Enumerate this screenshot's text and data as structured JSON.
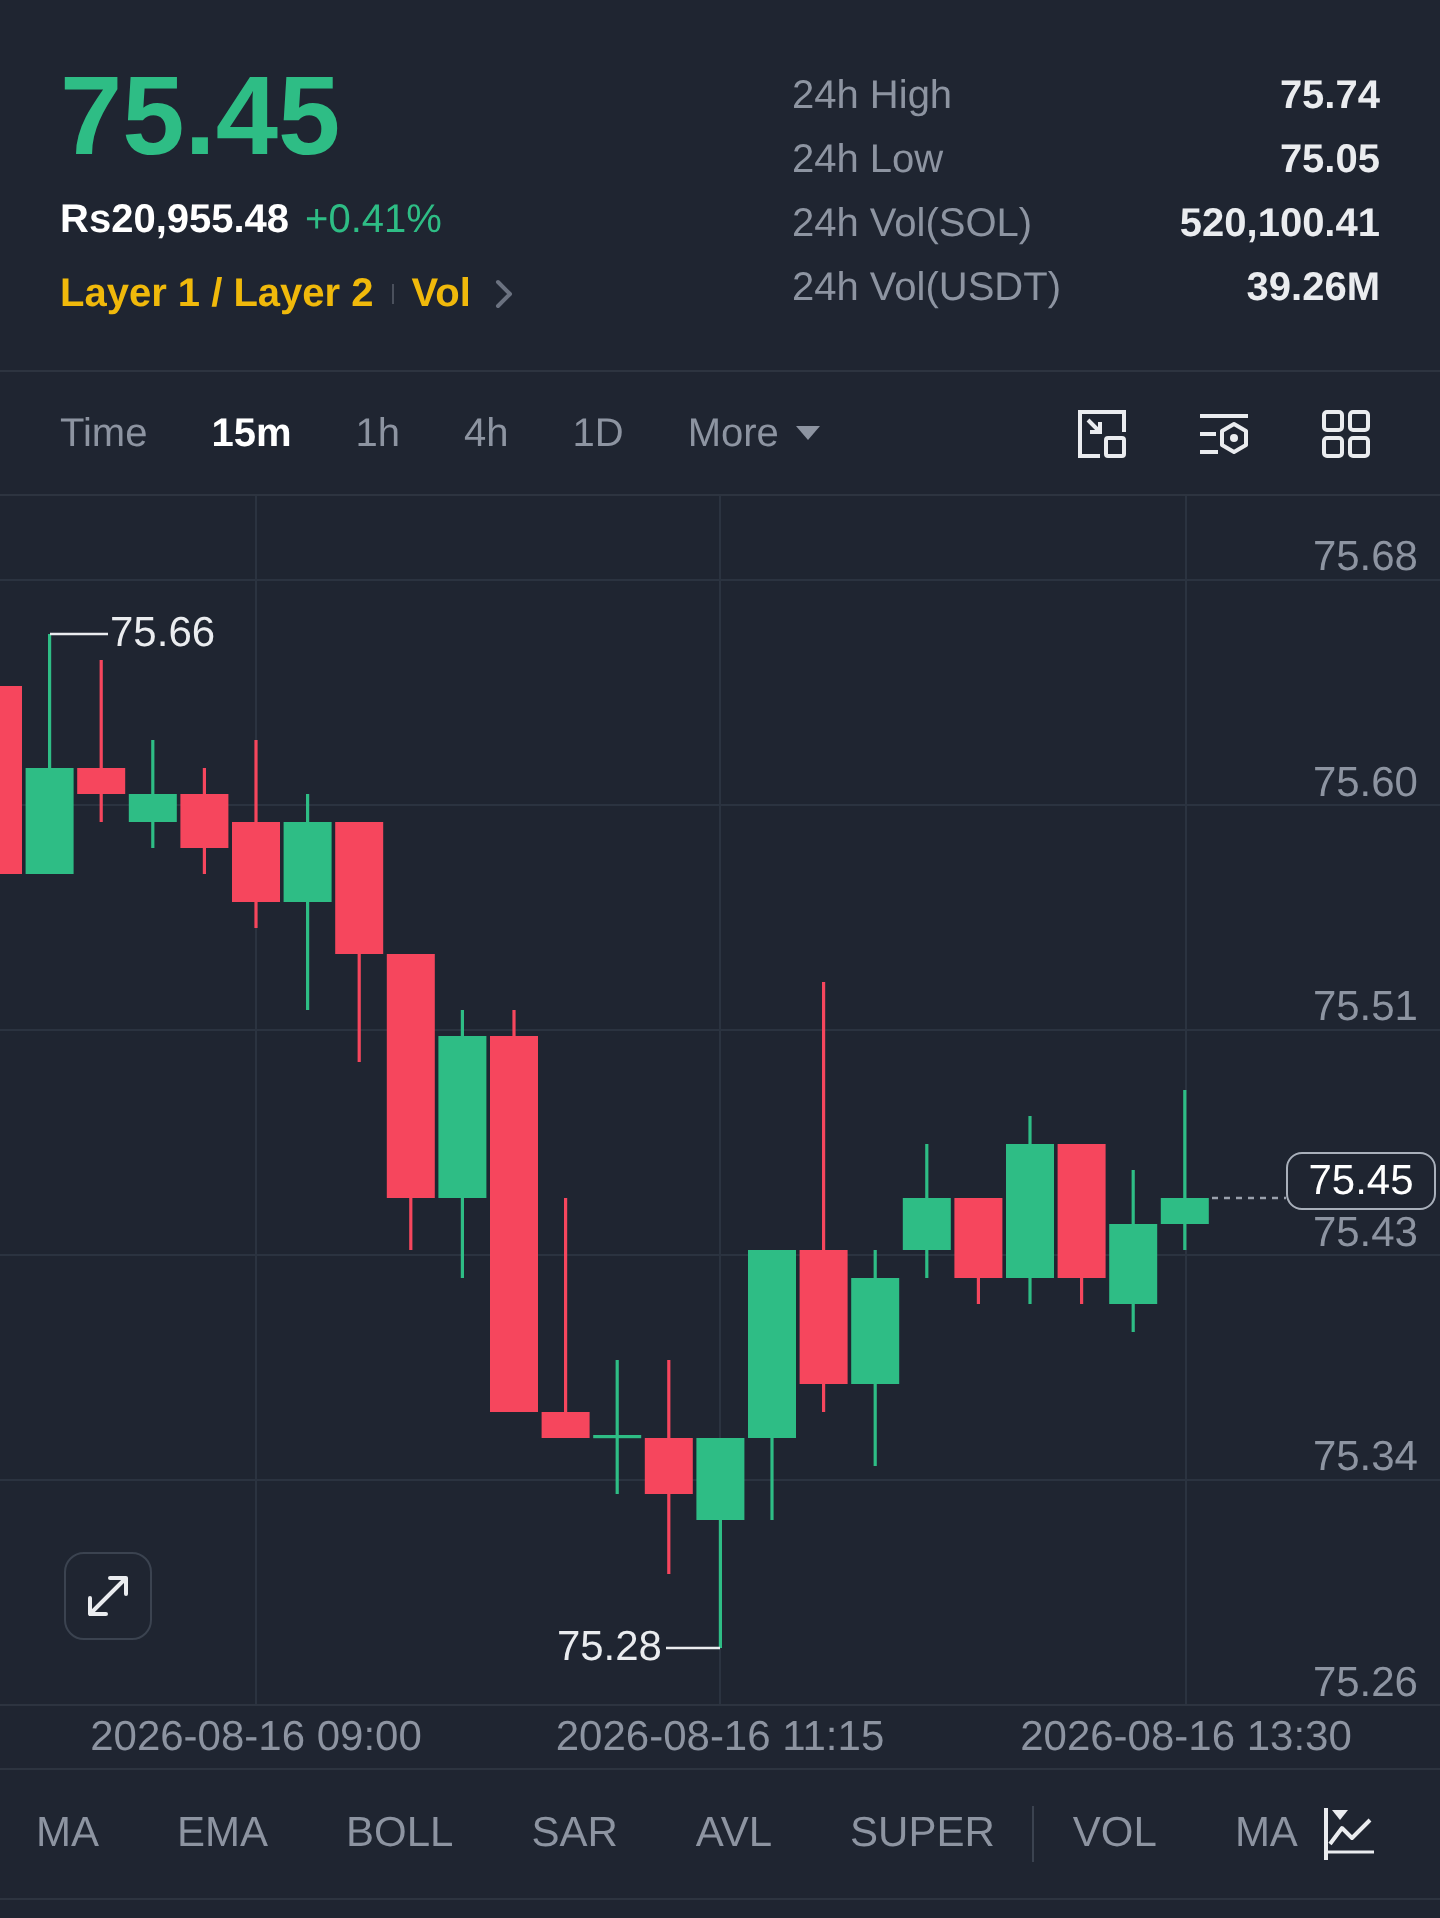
{
  "ticker": {
    "last_price": "75.45",
    "rising": true,
    "fiat_price": "Rs20,955.48",
    "change": "+0.41%",
    "tags": [
      "Layer 1 / Layer 2",
      "Vol"
    ]
  },
  "stats": [
    {
      "label": "24h High",
      "value": "75.74"
    },
    {
      "label": "24h Low",
      "value": "75.05"
    },
    {
      "label": "24h Vol(SOL)",
      "value": "520,100.41"
    },
    {
      "label": "24h Vol(USDT)",
      "value": "39.26M"
    }
  ],
  "intervals": [
    {
      "kind": "option",
      "label": "Time",
      "selected": false
    },
    {
      "kind": "option",
      "label": "15m",
      "selected": true
    },
    {
      "kind": "option",
      "label": "1h",
      "selected": false
    },
    {
      "kind": "option",
      "label": "4h",
      "selected": false
    },
    {
      "kind": "option",
      "label": "1D",
      "selected": false
    },
    {
      "kind": "dropdown",
      "label": "More",
      "selected": false
    }
  ],
  "chart": {
    "price_labels": [
      "75.68",
      "75.60",
      "75.51",
      "75.43",
      "75.34",
      "75.26"
    ],
    "time_labels": [
      "2026-08-16 09:00",
      "2026-08-16 11:15",
      "2026-08-16 13:30"
    ],
    "high_marker": "75.66",
    "low_marker": "75.28",
    "last_price_tag": "75.45"
  },
  "indicators": {
    "main": [
      "MA",
      "EMA",
      "BOLL",
      "SAR",
      "AVL",
      "SUPER"
    ],
    "sub": [
      "VOL",
      "MA"
    ]
  }
}
